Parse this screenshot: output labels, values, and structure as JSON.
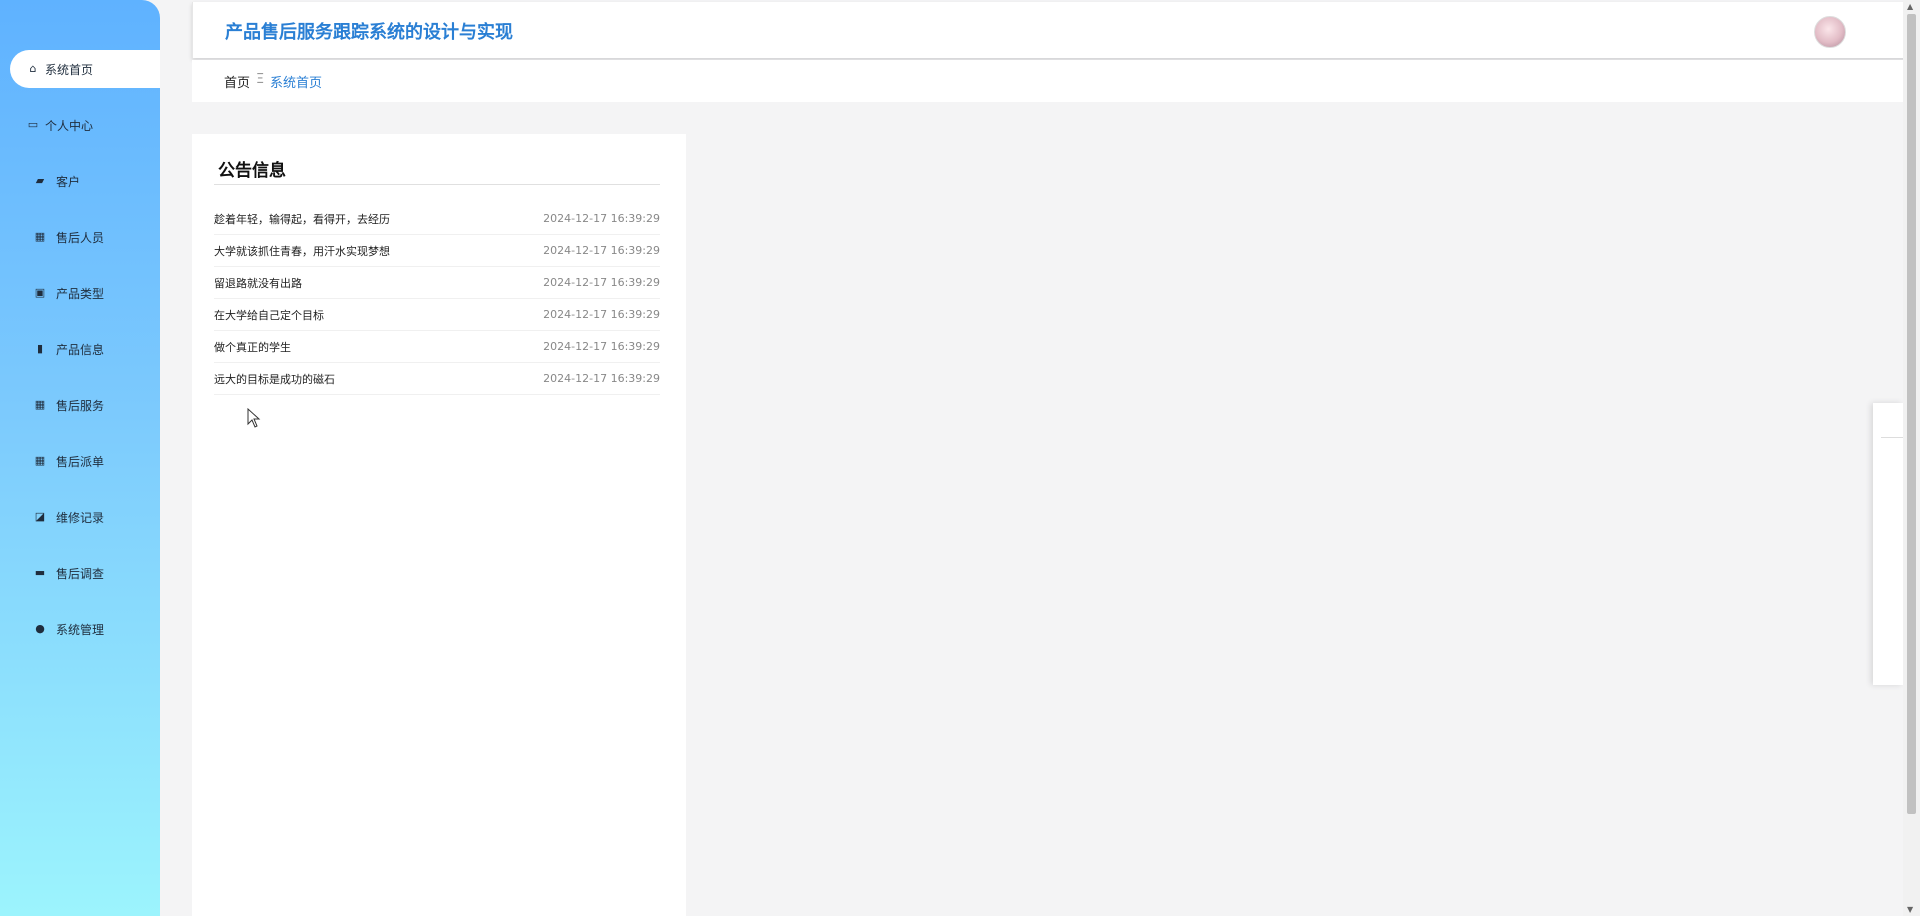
{
  "header": {
    "title": "产品售后服务跟踪系统的设计与实现"
  },
  "breadcrumb": {
    "home": "首页",
    "separator": "Ξ",
    "current": "系统首页"
  },
  "sidebar": {
    "items": [
      {
        "label": "系统首页",
        "icon": "home-icon"
      },
      {
        "label": "个人中心",
        "icon": "id-card-icon"
      },
      {
        "label": "客户",
        "icon": "wallet-icon"
      },
      {
        "label": "售后人员",
        "icon": "grid-icon"
      },
      {
        "label": "产品类型",
        "icon": "clipboard-icon"
      },
      {
        "label": "产品信息",
        "icon": "chart-icon"
      },
      {
        "label": "售后服务",
        "icon": "grid-icon"
      },
      {
        "label": "售后派单",
        "icon": "grid-icon"
      },
      {
        "label": "维修记录",
        "icon": "trend-icon"
      },
      {
        "label": "售后调查",
        "icon": "monitor-icon"
      },
      {
        "label": "系统管理",
        "icon": "user-icon"
      }
    ]
  },
  "notice": {
    "title": "公告信息",
    "items": [
      {
        "text": "趁着年轻，输得起，看得开，去经历",
        "time": "2024-12-17 16:39:29"
      },
      {
        "text": "大学就该抓住青春，用汗水实现梦想",
        "time": "2024-12-17 16:39:29"
      },
      {
        "text": "留退路就没有出路",
        "time": "2024-12-17 16:39:29"
      },
      {
        "text": "在大学给自己定个目标",
        "time": "2024-12-17 16:39:29"
      },
      {
        "text": "做个真正的学生",
        "time": "2024-12-17 16:39:29"
      },
      {
        "text": "远大的目标是成功的磁石",
        "time": "2024-12-17 16:39:29"
      }
    ]
  },
  "colors": {
    "accent": "#2a7fd4",
    "sidebar_top": "#5fb2ff",
    "sidebar_bottom": "#9cf4fd"
  }
}
